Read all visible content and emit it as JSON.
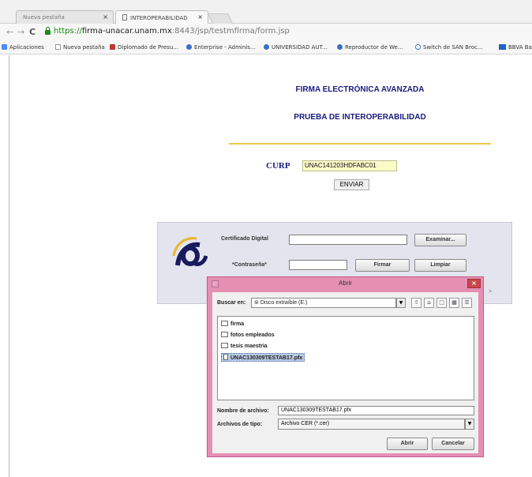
{
  "browser": {
    "tabs": [
      {
        "label": "Nueva pestaña"
      },
      {
        "label": "INTEROPERABILIDAD"
      }
    ],
    "tab_close_glyph": "×",
    "url": {
      "scheme": "https://",
      "host": "firma-unacar.unam.mx",
      "rest": ":8443/jsp/testmfirma/form.jsp"
    },
    "nav": {
      "back": "←",
      "forward": "→",
      "reload": "C"
    },
    "bookmarks": [
      {
        "label": "Aplicaciones",
        "icon": "apps-grid-icon",
        "color": "#4a8af4"
      },
      {
        "label": "Nueva pestaña",
        "icon": "page-icon",
        "color": "#ffffff"
      },
      {
        "label": "Diplomado de Presu...",
        "icon": "bookmark-pdf-icon",
        "color": "#c0392b"
      },
      {
        "label": "Enterprise - Adminis...",
        "icon": "globe-icon",
        "color": "#3b6fc9"
      },
      {
        "label": "UNIVERSIDAD AUT...",
        "icon": "globe-icon",
        "color": "#3b6fc9"
      },
      {
        "label": "Reproductor de We...",
        "icon": "globe-icon",
        "color": "#3b6fc9"
      },
      {
        "label": "Switch de SAN Broc...",
        "icon": "router-icon",
        "color": "#3b6fc9"
      },
      {
        "label": "BBVA Ba",
        "icon": "bank-icon",
        "color": "#1e64c8"
      }
    ]
  },
  "page": {
    "title": "FIRMA ELECTRÓNICA AVANZADA",
    "subtitle": "PRUEBA DE INTEROPERABILIDAD",
    "curp_label": "CURP",
    "curp_value": "UNAC141203HDFABC01",
    "send_button": "ENVIAR"
  },
  "applet": {
    "cert_label": "Certificado Digital",
    "password_label": "*Contraseña*",
    "browse_button": "Examinar...",
    "sign_button": "Firmar",
    "clear_button": "Limpiar",
    "arrow_glyph": ">"
  },
  "dialog": {
    "title": "Abrir",
    "close_glyph": "×",
    "search_label": "Buscar en:",
    "location": "Disco extraíble (E:)",
    "files": [
      {
        "name": "firma",
        "type": "folder"
      },
      {
        "name": "fotos empleados",
        "type": "folder"
      },
      {
        "name": "tesis maestria",
        "type": "folder"
      },
      {
        "name": "UNAC130309TESTAB17.pfx",
        "type": "file",
        "selected": true
      }
    ],
    "filename_label": "Nombre de archivo:",
    "filename_value": "UNAC130309TESTAB17.pfx",
    "filetype_label": "Archivos de tipo:",
    "filetype_value": "Archivo CER (*.cer)",
    "open_button": "Abrir",
    "cancel_button": "Cancelar",
    "toolbar_icons": [
      "up-folder-icon",
      "home-folder-icon",
      "new-folder-icon",
      "list-view-icon",
      "details-view-icon"
    ]
  },
  "colors": {
    "title_blue": "#1a1a7e",
    "gold_rule": "#e8c84a",
    "dialog_frame": "#e58fb3",
    "selection": "#b9cbe4"
  }
}
